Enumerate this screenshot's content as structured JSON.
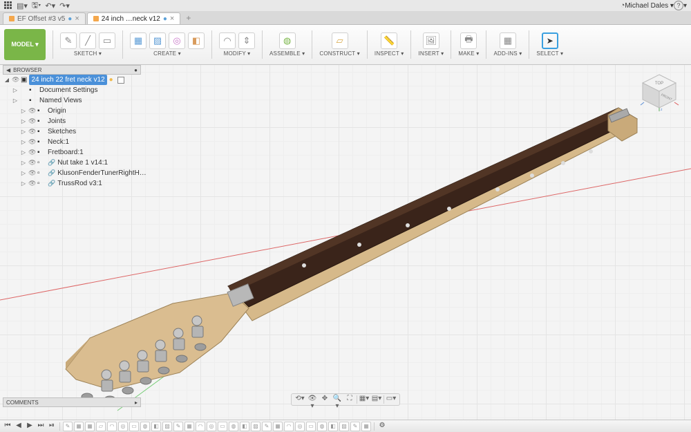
{
  "sysbar": {
    "user": "Michael Dales",
    "recent_icon": "clock-icon"
  },
  "tabs": [
    {
      "label": "EF Offset #3 v5",
      "active": false
    },
    {
      "label": "24 inch …neck v12",
      "active": true
    }
  ],
  "toolbar": {
    "model": "MODEL ▾",
    "groups": [
      {
        "label": "SKETCH ▾"
      },
      {
        "label": "CREATE ▾"
      },
      {
        "label": "MODIFY ▾"
      },
      {
        "label": "ASSEMBLE ▾"
      },
      {
        "label": "CONSTRUCT ▾"
      },
      {
        "label": "INSPECT ▾"
      },
      {
        "label": "INSERT ▾"
      },
      {
        "label": "MAKE ▾"
      },
      {
        "label": "ADD-INS ▾"
      },
      {
        "label": "SELECT ▾"
      }
    ]
  },
  "browser": {
    "title": "BROWSER",
    "root": "24 inch 22 fret neck v12",
    "items": [
      {
        "label": "Document Settings",
        "icon": "⚙",
        "indent": 1,
        "expandable": true
      },
      {
        "label": "Named Views",
        "icon": "▥",
        "indent": 1,
        "expandable": true
      },
      {
        "label": "Origin",
        "icon": "⌖",
        "indent": 2,
        "expandable": true,
        "eye": true
      },
      {
        "label": "Joints",
        "icon": "⬚",
        "indent": 2,
        "expandable": true,
        "eye": true
      },
      {
        "label": "Sketches",
        "icon": "▭",
        "indent": 2,
        "expandable": true,
        "eye": true
      },
      {
        "label": "Neck:1",
        "icon": "▭",
        "indent": 2,
        "expandable": true,
        "eye": true
      },
      {
        "label": "Fretboard:1",
        "icon": "▭",
        "indent": 2,
        "expandable": true,
        "eye": true
      },
      {
        "label": "Nut take 1 v14:1",
        "icon": "🔗",
        "indent": 2,
        "expandable": true,
        "eye": true,
        "link": true
      },
      {
        "label": "KlusonFenderTunerRightH…",
        "icon": "🔗",
        "indent": 2,
        "expandable": true,
        "eye": true,
        "link": true
      },
      {
        "label": "TrussRod v3:1",
        "icon": "🔗",
        "indent": 2,
        "expandable": true,
        "eye": true,
        "link": true
      }
    ]
  },
  "comments": {
    "title": "COMMENTS"
  },
  "viewcube": {
    "top": "TOP",
    "front": "FRONT"
  },
  "timeline": {
    "transport": [
      "⏮",
      "◀",
      "▶",
      "⏭",
      "⏯"
    ],
    "feature_count": 28
  }
}
